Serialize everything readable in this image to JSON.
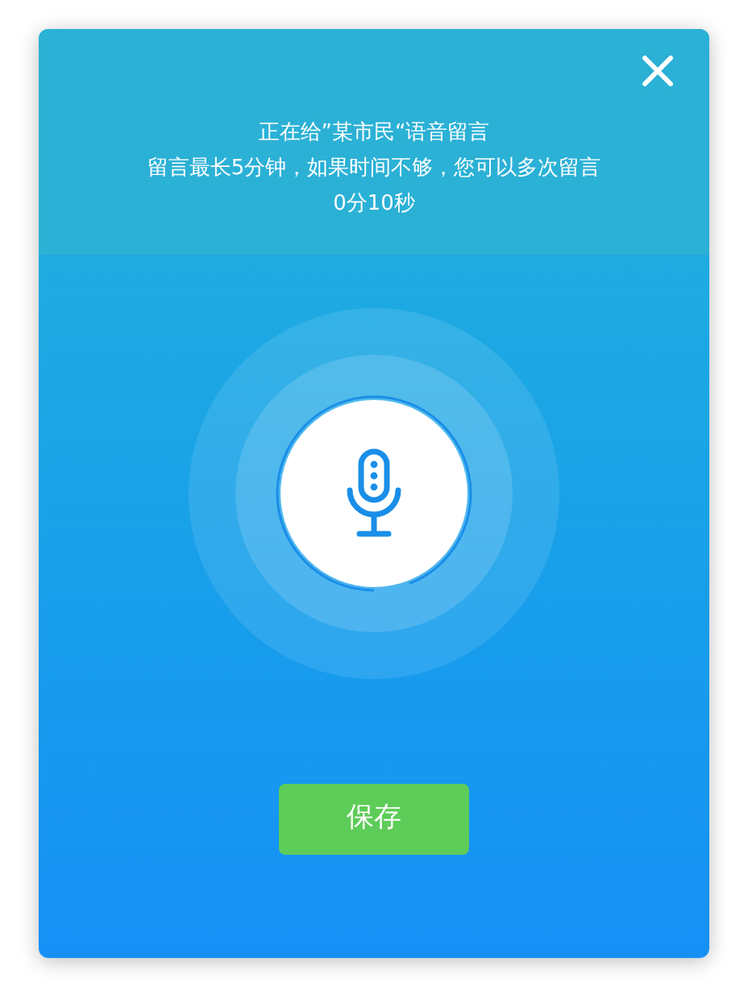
{
  "dialog": {
    "lines": [
      "正在给”某市民“语音留言",
      "留言最长5分钟，如果时间不够，您可以多次留言",
      "0分10秒"
    ]
  },
  "recorder": {
    "level": 0.94
  },
  "save_button": {
    "label": "保存"
  }
}
